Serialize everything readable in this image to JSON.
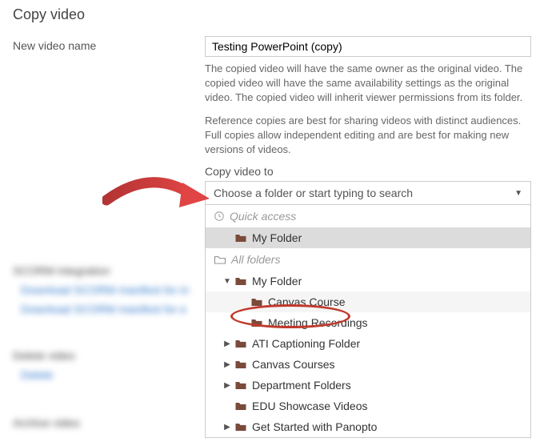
{
  "title": "Copy video",
  "name_label": "New video name",
  "name_value": "Testing PowerPoint (copy)",
  "info1": "The copied video will have the same owner as the original video. The copied video will have the same availability settings as the original video. The copied video will inherit viewer permissions from its folder.",
  "info2": "Reference copies are best for sharing videos with distinct audiences. Full copies allow independent editing and are best for making new versions of videos.",
  "copy_to_label": "Copy video to",
  "dropdown_placeholder": "Choose a folder or start typing to search",
  "quick_access": "Quick access",
  "all_folders": "All folders",
  "folders": {
    "my_folder": "My Folder",
    "canvas_course": "Canvas Course",
    "meeting_recordings": "Meeting Recordings",
    "ati_captioning": "ATI Captioning Folder",
    "canvas_courses": "Canvas Courses",
    "department_folders": "Department Folders",
    "edu_showcase": "EDU Showcase Videos",
    "get_started": "Get Started with Panopto"
  },
  "bg": {
    "scorm_head": "SCORM integration",
    "scorm_link1": "Download SCORM manifest for in",
    "scorm_link2": "Download SCORM manifest for e",
    "delete_head": "Delete video",
    "delete_link": "Delete",
    "archive_head": "Archive video"
  }
}
